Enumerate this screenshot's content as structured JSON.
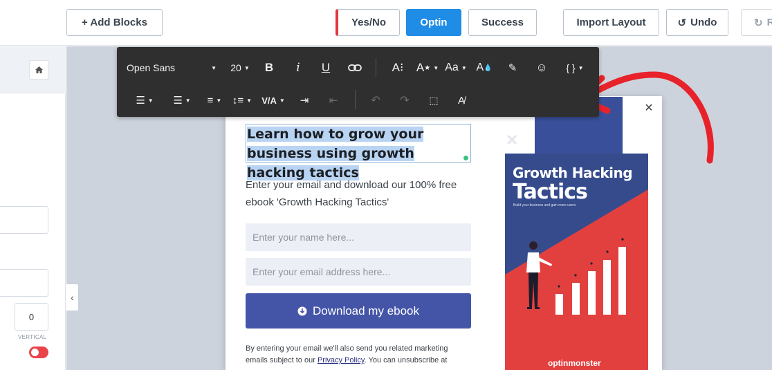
{
  "topbar": {
    "add_blocks": "+ Add Blocks",
    "views": [
      {
        "label": "Yes/No"
      },
      {
        "label": "Optin"
      },
      {
        "label": "Success"
      }
    ],
    "import_layout": "Import Layout",
    "undo": "Undo",
    "redo": "R"
  },
  "sidebar": {
    "number_value": "0",
    "vertical_label": "VERTICAL"
  },
  "toolbar": {
    "font_family": "Open Sans",
    "font_size": "20",
    "case_label": "Aa",
    "code_label": "{ }",
    "letter_spacing_label": "V/A"
  },
  "popup": {
    "headline": "Learn how to grow your business using growth hacking tactics",
    "subtext": "Enter your email and download our 100% free ebook 'Growth Hacking Tactics'",
    "name_placeholder": "Enter your name here...",
    "email_placeholder": "Enter your email address here...",
    "cta": "Download my ebook",
    "fine_print_before": "By entering your email we'll also send you related marketing emails subject to our ",
    "fine_print_link": "Privacy Policy",
    "fine_print_after": ". You can unsubscribe at"
  },
  "ebook": {
    "title_line1": "Growth Hacking",
    "title_line2": "Tactics",
    "tagline": "Build your business and gain more users",
    "brand": "optinmonster"
  },
  "colors": {
    "accent_blue": "#1f8ce6",
    "cta_blue": "#4455a8",
    "ebook_red": "#e2403f",
    "ebook_navy": "#364b8c",
    "arrow_red": "#e8222b",
    "toolbar_bg": "#2f2f2f"
  }
}
